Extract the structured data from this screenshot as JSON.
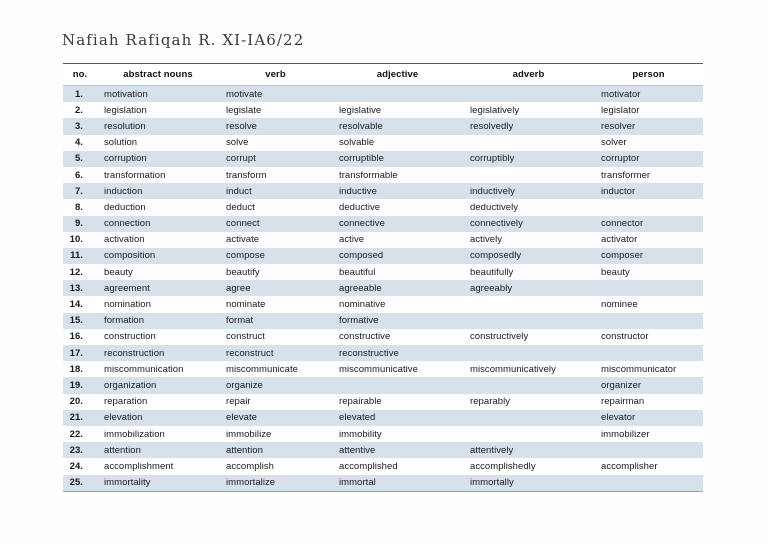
{
  "document": {
    "title": "Nafiah Rafiqah R.  XI-IA6/22",
    "background_color": "#fefefe"
  },
  "table": {
    "accent_row_color": "#d7e1ec",
    "plain_row_color": "#ffffff",
    "border_color": "#5a5a5a",
    "columns": [
      {
        "key": "no",
        "label": "no."
      },
      {
        "key": "abstract_noun",
        "label": "abstract nouns"
      },
      {
        "key": "verb",
        "label": "verb"
      },
      {
        "key": "adjective",
        "label": "adjective"
      },
      {
        "key": "adverb",
        "label": "adverb"
      },
      {
        "key": "person",
        "label": "person"
      }
    ],
    "rows": [
      {
        "no": "1.",
        "abstract_noun": "motivation",
        "verb": "motivate",
        "adjective": "",
        "adverb": "",
        "person": "motivator"
      },
      {
        "no": "2.",
        "abstract_noun": "legislation",
        "verb": "legislate",
        "adjective": "legislative",
        "adverb": "legislatively",
        "person": "legislator"
      },
      {
        "no": "3.",
        "abstract_noun": "resolution",
        "verb": "resolve",
        "adjective": "resolvable",
        "adverb": "resolvedly",
        "person": "resolver"
      },
      {
        "no": "4.",
        "abstract_noun": "solution",
        "verb": "solve",
        "adjective": "solvable",
        "adverb": "",
        "person": "solver"
      },
      {
        "no": "5.",
        "abstract_noun": "corruption",
        "verb": "corrupt",
        "adjective": "corruptible",
        "adverb": "corruptibly",
        "person": "corruptor"
      },
      {
        "no": "6.",
        "abstract_noun": "transformation",
        "verb": "transform",
        "adjective": "transformable",
        "adverb": "",
        "person": "transformer"
      },
      {
        "no": "7.",
        "abstract_noun": "induction",
        "verb": "induct",
        "adjective": "inductive",
        "adverb": "inductively",
        "person": "inductor"
      },
      {
        "no": "8.",
        "abstract_noun": "deduction",
        "verb": "deduct",
        "adjective": "deductive",
        "adverb": "deductively",
        "person": ""
      },
      {
        "no": "9.",
        "abstract_noun": "connection",
        "verb": "connect",
        "adjective": "connective",
        "adverb": "connectively",
        "person": "connector"
      },
      {
        "no": "10.",
        "abstract_noun": "activation",
        "verb": "activate",
        "adjective": "active",
        "adverb": "actively",
        "person": "activator"
      },
      {
        "no": "11.",
        "abstract_noun": "composition",
        "verb": "compose",
        "adjective": "composed",
        "adverb": "composedly",
        "person": "composer"
      },
      {
        "no": "12.",
        "abstract_noun": "beauty",
        "verb": "beautify",
        "adjective": "beautiful",
        "adverb": "beautifully",
        "person": "beauty"
      },
      {
        "no": "13.",
        "abstract_noun": "agreement",
        "verb": "agree",
        "adjective": "agreeable",
        "adverb": "agreeably",
        "person": ""
      },
      {
        "no": "14.",
        "abstract_noun": "nomination",
        "verb": "nominate",
        "adjective": "nominative",
        "adverb": "",
        "person": "nominee"
      },
      {
        "no": "15.",
        "abstract_noun": "formation",
        "verb": "format",
        "adjective": "formative",
        "adverb": "",
        "person": ""
      },
      {
        "no": "16.",
        "abstract_noun": "construction",
        "verb": "construct",
        "adjective": "constructive",
        "adverb": "constructively",
        "person": "constructor"
      },
      {
        "no": "17.",
        "abstract_noun": "reconstruction",
        "verb": "reconstruct",
        "adjective": "reconstructive",
        "adverb": "",
        "person": ""
      },
      {
        "no": "18.",
        "abstract_noun": "miscommunication",
        "verb": "miscommunicate",
        "adjective": "miscommunicative",
        "adverb": "miscommunicatively",
        "person": "miscommunicator"
      },
      {
        "no": "19.",
        "abstract_noun": "organization",
        "verb": "organize",
        "adjective": "",
        "adverb": "",
        "person": "organizer"
      },
      {
        "no": "20.",
        "abstract_noun": "reparation",
        "verb": "repair",
        "adjective": "repairable",
        "adverb": "reparably",
        "person": "repairman"
      },
      {
        "no": "21.",
        "abstract_noun": "elevation",
        "verb": "elevate",
        "adjective": "elevated",
        "adverb": "",
        "person": "elevator"
      },
      {
        "no": "22.",
        "abstract_noun": "immobilization",
        "verb": "immobilize",
        "adjective": "immobility",
        "adverb": "",
        "person": "immobilizer"
      },
      {
        "no": "23.",
        "abstract_noun": "attention",
        "verb": "attention",
        "adjective": "attentive",
        "adverb": "attentively",
        "person": ""
      },
      {
        "no": "24.",
        "abstract_noun": "accomplishment",
        "verb": "accomplish",
        "adjective": "accomplished",
        "adverb": "accomplishedly",
        "person": "accomplisher"
      },
      {
        "no": "25.",
        "abstract_noun": "immortality",
        "verb": "immortalize",
        "adjective": "immortal",
        "adverb": "immortally",
        "person": ""
      }
    ]
  }
}
